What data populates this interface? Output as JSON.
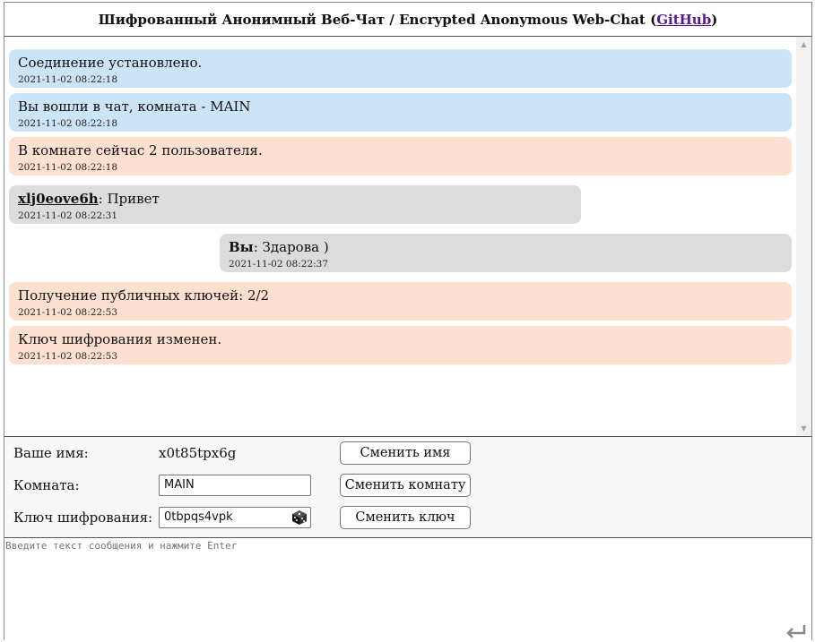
{
  "header": {
    "title": "Шифрованный Анонимный Веб-Чат / Encrypted Anonymous Web-Chat (",
    "link": "GitHub",
    "suffix": ")"
  },
  "messages": [
    {
      "kind": "system",
      "text": "Соединение установлено.",
      "time": "2021-11-02 08:22:18"
    },
    {
      "kind": "system",
      "text": "Вы вошли в чат, комната - MAIN",
      "time": "2021-11-02 08:22:18"
    },
    {
      "kind": "warn",
      "text": "В комнате сейчас 2 пользователя.",
      "time": "2021-11-02 08:22:18"
    },
    {
      "kind": "incoming",
      "user": "xlj0eove6h",
      "text": ": Привет",
      "time": "2021-11-02 08:22:31"
    },
    {
      "kind": "outgoing",
      "user": "Вы",
      "text": ": Здарова )",
      "time": "2021-11-02 08:22:37"
    },
    {
      "kind": "warn",
      "text": "Получение публичных ключей: 2/2",
      "time": "2021-11-02 08:22:53"
    },
    {
      "kind": "warn",
      "text": "Ключ шифрования изменен.",
      "time": "2021-11-02 08:22:53"
    }
  ],
  "controls": {
    "name_label": "Ваше имя:",
    "name_value": "x0t85tpx6g",
    "change_name": "Сменить имя",
    "room_label": "Комната:",
    "room_value": "MAIN",
    "change_room": "Сменить комнату",
    "key_label": "Ключ шифрования:",
    "key_value": "0tbpqs4vpk",
    "change_key": "Сменить ключ"
  },
  "compose": {
    "placeholder": "Введите текст сообщения и нажмите Enter"
  },
  "colors": {
    "system": "#cce4f7",
    "warn": "#fde0d0",
    "user": "#dcdcdc"
  },
  "icons": {
    "dice": "dice-icon",
    "send": "enter-icon"
  }
}
